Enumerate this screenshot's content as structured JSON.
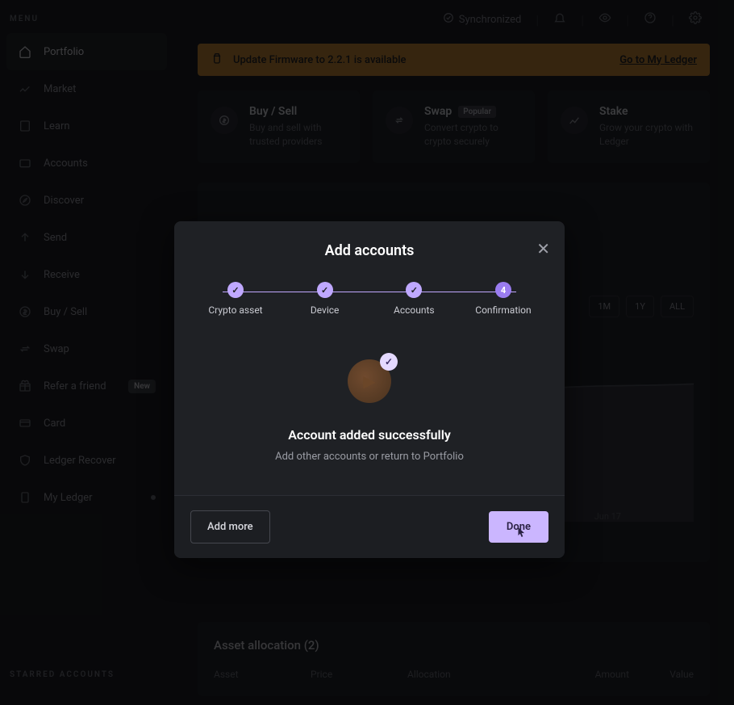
{
  "sidebar": {
    "menu_label": "MENU",
    "starred_label": "STARRED ACCOUNTS",
    "items": [
      {
        "label": "Portfolio",
        "icon": "home-icon",
        "active": true
      },
      {
        "label": "Market",
        "icon": "chart-icon"
      },
      {
        "label": "Learn",
        "icon": "book-icon"
      },
      {
        "label": "Accounts",
        "icon": "wallet-icon"
      },
      {
        "label": "Discover",
        "icon": "compass-icon"
      },
      {
        "label": "Send",
        "icon": "upload-icon"
      },
      {
        "label": "Receive",
        "icon": "download-icon"
      },
      {
        "label": "Buy / Sell",
        "icon": "dollar-icon"
      },
      {
        "label": "Swap",
        "icon": "swap-icon"
      },
      {
        "label": "Refer a friend",
        "icon": "gift-icon",
        "badge": "New"
      },
      {
        "label": "Card",
        "icon": "card-icon"
      },
      {
        "label": "Ledger Recover",
        "icon": "shield-icon"
      },
      {
        "label": "My Ledger",
        "icon": "ledger-icon",
        "dot": true
      }
    ]
  },
  "topbar": {
    "sync_label": "Synchronized"
  },
  "banner": {
    "message": "Update Firmware to 2.2.1 is available",
    "link": "Go to My Ledger"
  },
  "action_cards": [
    {
      "title": "Buy / Sell",
      "subtitle": "Buy and sell with trusted providers"
    },
    {
      "title": "Swap",
      "badge": "Popular",
      "subtitle": "Convert crypto to crypto securely"
    },
    {
      "title": "Stake",
      "subtitle": "Grow your crypto with Ledger"
    }
  ],
  "timeframes": [
    "1M",
    "1Y",
    "ALL"
  ],
  "chart_date": "Jun 17",
  "asset_allocation": {
    "title": "Asset allocation (2)",
    "columns": [
      "Asset",
      "Price",
      "Allocation",
      "Amount",
      "Value"
    ]
  },
  "modal": {
    "title": "Add accounts",
    "steps": [
      {
        "label": "Crypto asset",
        "state": "done"
      },
      {
        "label": "Device",
        "state": "done"
      },
      {
        "label": "Accounts",
        "state": "done"
      },
      {
        "label": "Confirmation",
        "state": "current",
        "number": "4"
      }
    ],
    "success_title": "Account added successfully",
    "success_sub": "Add other accounts or return to Portfolio",
    "btn_secondary": "Add more",
    "btn_primary": "Done"
  }
}
